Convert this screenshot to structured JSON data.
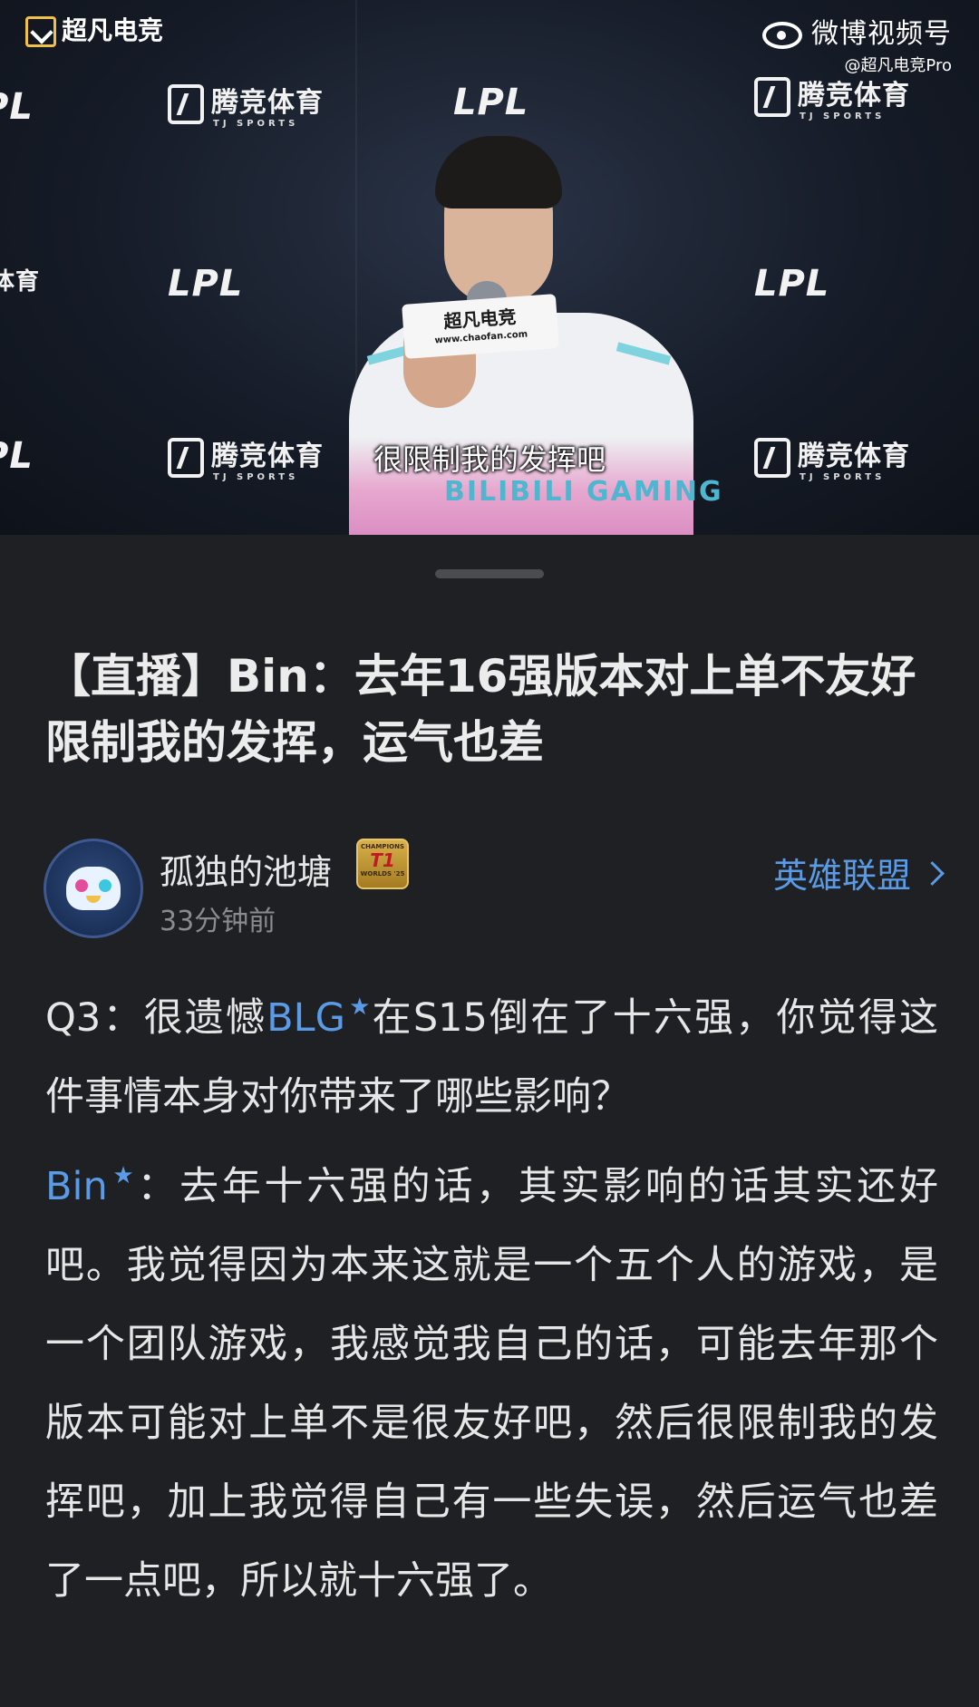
{
  "video": {
    "channel_logo_text": "超凡电竞",
    "weibo_label": "微博视频号",
    "weibo_handle": "@超凡电竞Pro",
    "wall_lpl": "LPL",
    "wall_tj": "腾竞体育",
    "wall_tj_sub": "TJ SPORTS",
    "mic_flag_text": "超凡电竞",
    "mic_flag_url": "www.chaofan.com",
    "jersey_text": "BILIBILI GAMING",
    "subtitle": "很限制我的发挥吧"
  },
  "post": {
    "title": "【直播】Bin：去年16强版本对上单不友好限制我的发挥，运气也差",
    "author": {
      "name": "孤独的池塘",
      "time": "33分钟前",
      "badge_top": "CHAMPIONS",
      "badge_mid": "T1",
      "badge_bottom": "WORLDS '25"
    },
    "topic": "英雄联盟",
    "body": {
      "q_prefix": "Q3：很遗憾",
      "q_team": "BLG",
      "q_rest": "在S15倒在了十六强，你觉得这件事情本身对你带来了哪些影响？",
      "a_player": "Bin",
      "a_rest": "：去年十六强的话，其实影响的话其实还好吧。我觉得因为本来这就是一个五个人的游戏，是一个团队游戏，我感觉我自己的话，可能去年那个版本可能对上单不是很友好吧，然后很限制我的发挥吧，加上我觉得自己有一些失误，然后运气也差了一点吧，所以就十六强了。"
    }
  },
  "icons": {
    "star": "★",
    "chevron": "chevron-right-icon"
  },
  "colors": {
    "background": "#1f2023",
    "accent_link": "#5b9be6",
    "text_primary": "#e6e6e6",
    "text_secondary": "#8a8b8f"
  }
}
